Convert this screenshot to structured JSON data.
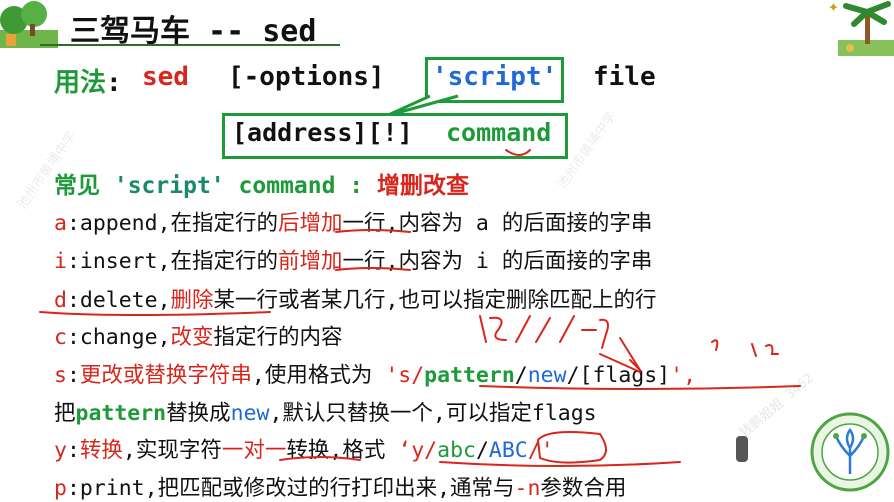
{
  "title": "三驾马车 -- sed",
  "usage": {
    "label": "用法",
    "colon": ":",
    "cmd": "sed",
    "options": "[-options]",
    "script": "'script'",
    "file": "file"
  },
  "address_line": {
    "address": "[address][!]",
    "command": "command"
  },
  "common_line": {
    "prefix": "常见",
    "script": "'script'",
    "command": "command",
    "colon": ":",
    "tail": "增删改查"
  },
  "commands": [
    {
      "key": "a",
      "sep": ":",
      "name": "append,",
      "pre": "在指定行的",
      "hl": "后增加",
      "post": "一行,内容为 a 的后面接的字串"
    },
    {
      "key": "i",
      "sep": ":",
      "name": "insert,",
      "pre": "在指定行的",
      "hl": "前增加",
      "post": "一行,内容为 i 的后面接的字串"
    },
    {
      "key": "d",
      "sep": ":",
      "name": "delete,",
      "pre": "",
      "hl": "删除",
      "post": "某一行或者某几行,也可以指定删除匹配上的行"
    },
    {
      "key": "c",
      "sep": ":",
      "name": "change,",
      "pre": "",
      "hl": "改变",
      "post": "指定行的内容"
    }
  ],
  "s_line": {
    "key": "s",
    "sep": ":",
    "hl": "更改或替换字符串",
    "mid": ",使用格式为 ",
    "q1": "'s/",
    "pattern": "pattern",
    "slash1": "/",
    "new": "new",
    "slash2": "/",
    "flags": "[flags]",
    "q2": "',"
  },
  "s_line2": {
    "pre": "把",
    "pattern": "pattern",
    "mid": "替换成",
    "new": "new",
    "post": ",默认只替换一个,可以指定flags"
  },
  "y_line": {
    "key": "y",
    "sep": ":",
    "hl": "转换",
    "pre": ",实现字符",
    "hl2": "一对一",
    "post": "转换,格式 ",
    "q1": "‘y/",
    "abc": "abc",
    "slash": "/",
    "ABC": "ABC",
    "q2": "/'"
  },
  "p_line": {
    "key": "p",
    "sep": ":",
    "pre": "print,把匹配或修改过的行打印出来,通常与",
    "n": "-n",
    "post": "参数合用"
  },
  "watermarks": [
    "池州市黄埔中学",
    "钱鹏姐姐 3462"
  ],
  "colors": {
    "green": "#1f9a3a",
    "red": "#d8261c",
    "blue": "#1f6ad8"
  }
}
